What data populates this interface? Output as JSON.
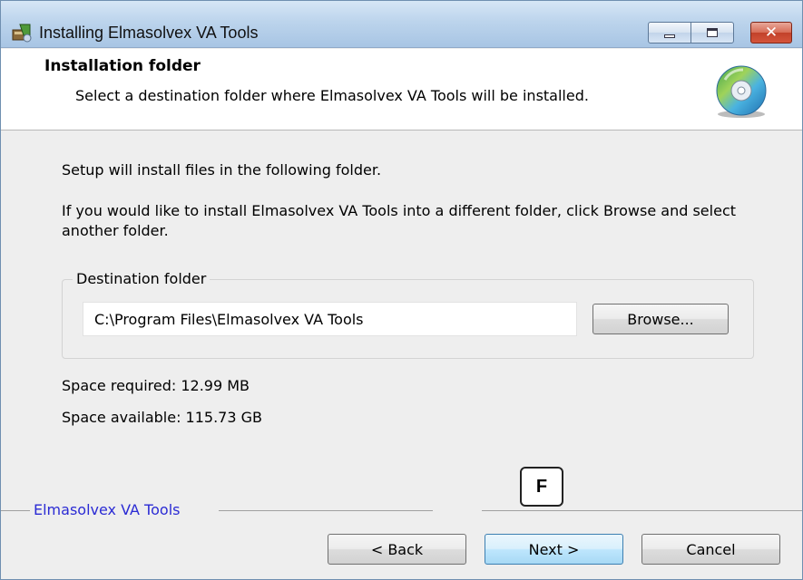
{
  "window": {
    "title": "Installing Elmasolvex VA Tools",
    "controls": {
      "minimize": "minimize",
      "maximize": "maximize",
      "close": "✕"
    }
  },
  "header": {
    "title": "Installation folder",
    "subtitle": "Select a destination folder where Elmasolvex VA Tools  will be installed.",
    "icon": "cd-icon"
  },
  "body": {
    "line1": "Setup will install files in the following folder.",
    "line2": "If you would like to install Elmasolvex VA Tools  into a different folder, click Browse and select another folder."
  },
  "destination": {
    "legend": "Destination folder",
    "path_value": "C:\\Program Files\\Elmasolvex VA Tools",
    "browse_label": "Browse..."
  },
  "space": {
    "required": "Space required: 12.99 MB",
    "available": "Space available: 115.73 GB"
  },
  "footer": {
    "brand": "Elmasolvex VA Tools",
    "marker": "F",
    "back_label": "< Back",
    "next_label": "Next >",
    "cancel_label": "Cancel"
  },
  "colors": {
    "brand_text": "#2b2bd4",
    "close_button": "#c2412a"
  }
}
